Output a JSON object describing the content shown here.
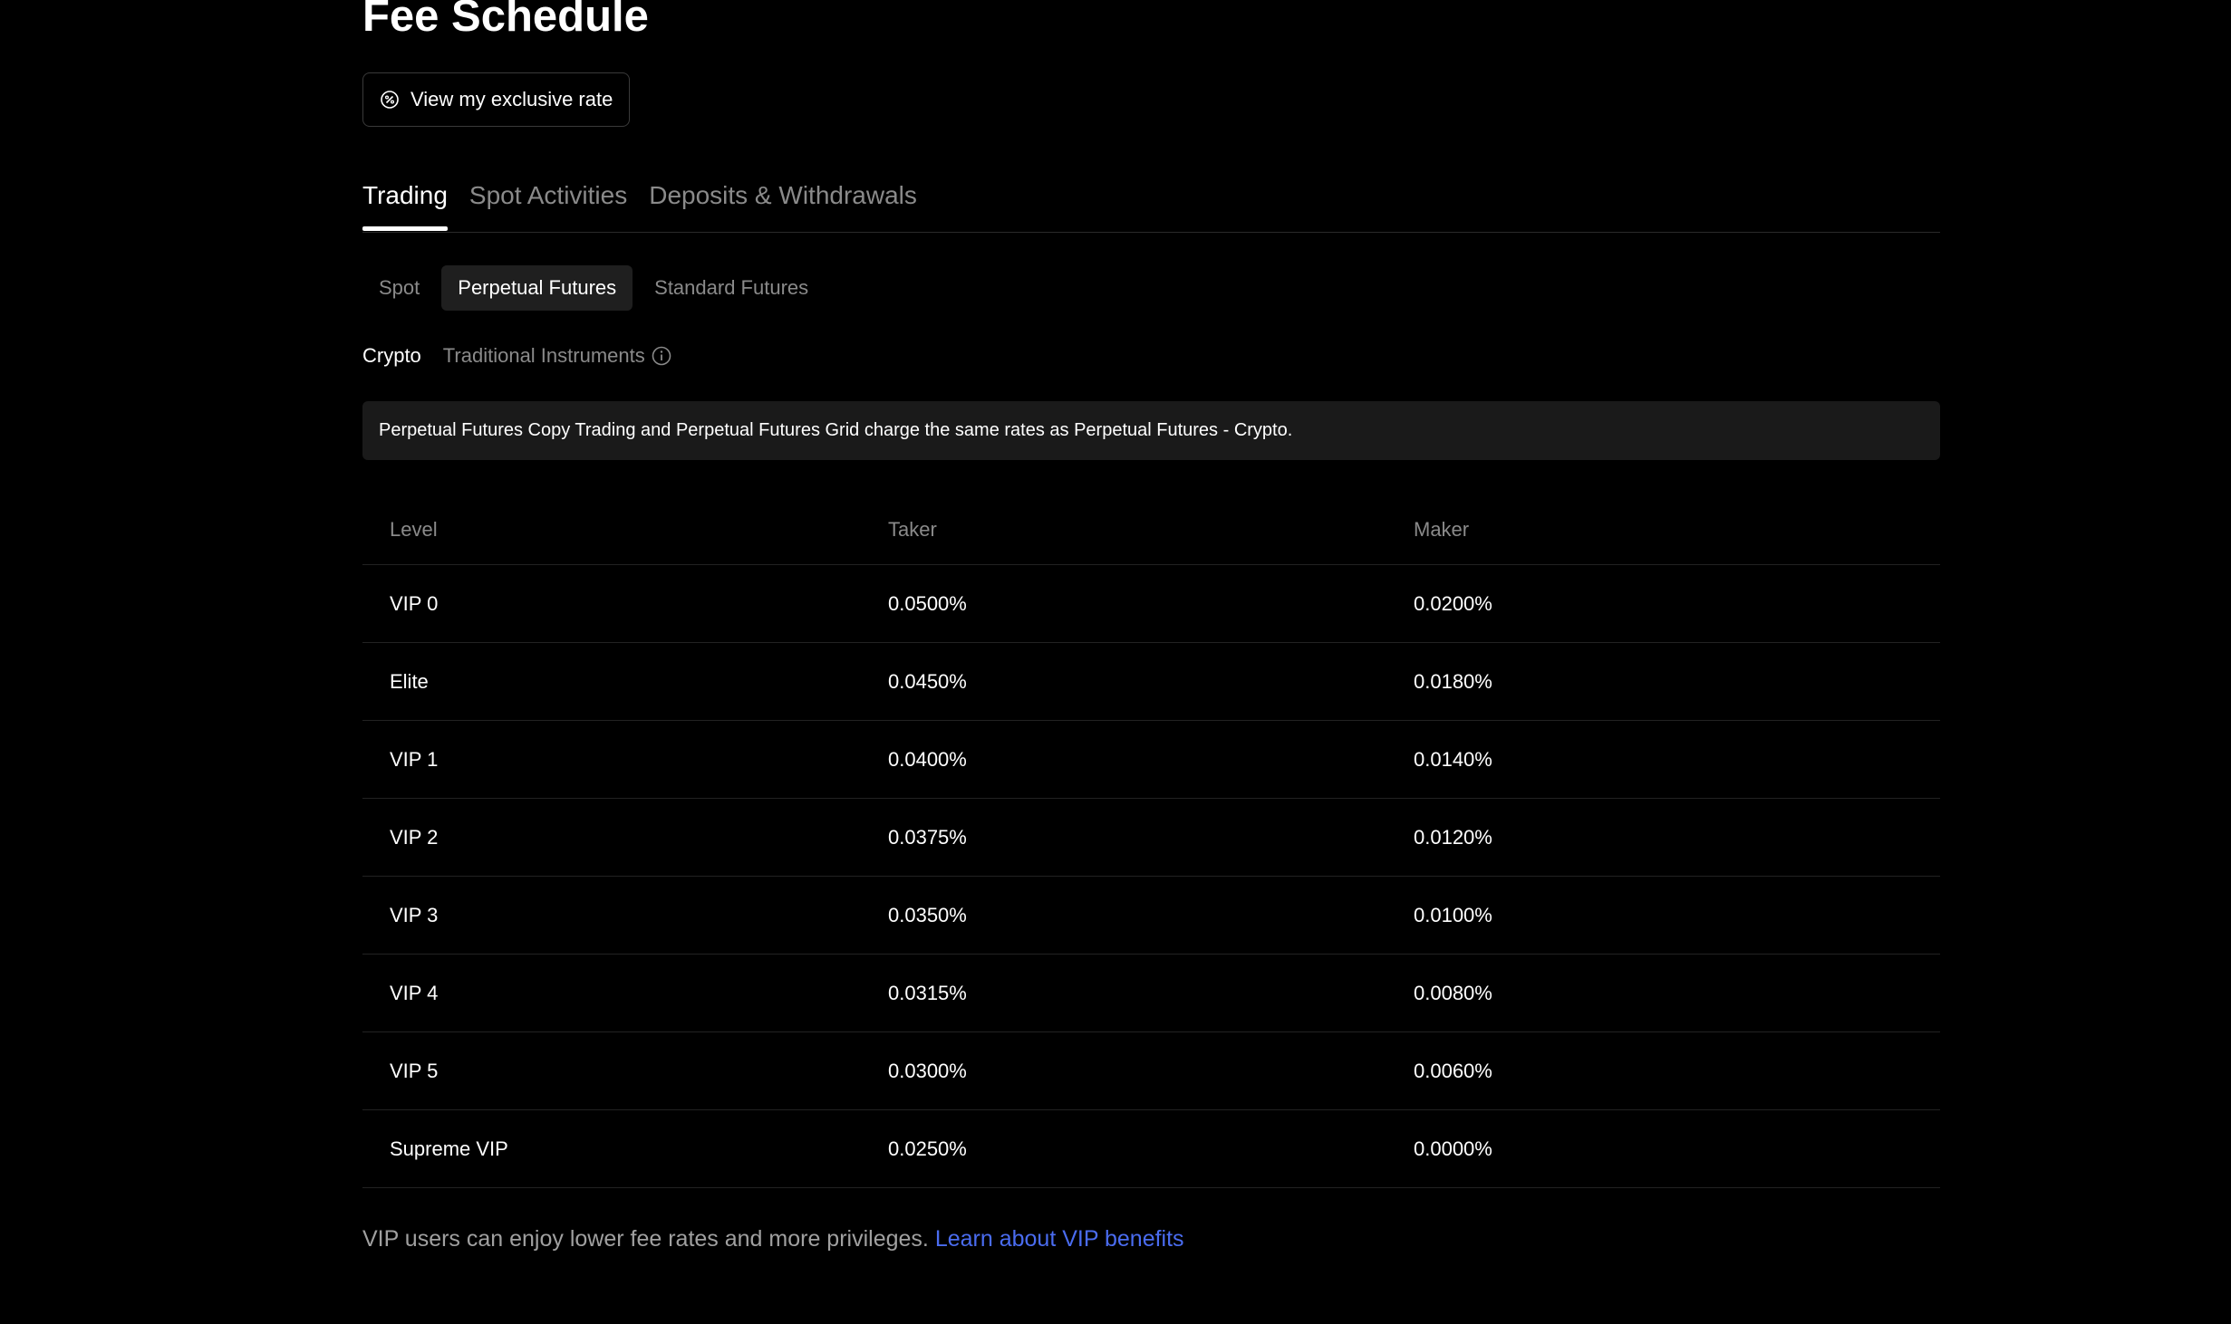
{
  "page_title": "Fee Schedule",
  "rate_button": {
    "label": "View my exclusive rate",
    "icon": "percent-circle-icon"
  },
  "main_tabs": [
    {
      "label": "Trading",
      "active": true
    },
    {
      "label": "Spot Activities",
      "active": false
    },
    {
      "label": "Deposits & Withdrawals",
      "active": false
    }
  ],
  "sub_tabs": [
    {
      "label": "Spot",
      "active": false
    },
    {
      "label": "Perpetual Futures",
      "active": true
    },
    {
      "label": "Standard Futures",
      "active": false
    }
  ],
  "asset_tabs": [
    {
      "label": "Crypto",
      "active": true
    },
    {
      "label": "Traditional Instruments",
      "active": false,
      "icon": "info-icon"
    }
  ],
  "notice": "Perpetual Futures Copy Trading and Perpetual Futures Grid charge the same rates as Perpetual Futures - Crypto.",
  "table": {
    "headers": {
      "level": "Level",
      "taker": "Taker",
      "maker": "Maker"
    },
    "rows": [
      {
        "level": "VIP 0",
        "taker": "0.0500%",
        "maker": "0.0200%"
      },
      {
        "level": "Elite",
        "taker": "0.0450%",
        "maker": "0.0180%"
      },
      {
        "level": "VIP 1",
        "taker": "0.0400%",
        "maker": "0.0140%"
      },
      {
        "level": "VIP 2",
        "taker": "0.0375%",
        "maker": "0.0120%"
      },
      {
        "level": "VIP 3",
        "taker": "0.0350%",
        "maker": "0.0100%"
      },
      {
        "level": "VIP 4",
        "taker": "0.0315%",
        "maker": "0.0080%"
      },
      {
        "level": "VIP 5",
        "taker": "0.0300%",
        "maker": "0.0060%"
      },
      {
        "level": "Supreme VIP",
        "taker": "0.0250%",
        "maker": "0.0000%"
      }
    ]
  },
  "footer": {
    "text": "VIP users can enjoy lower fee rates and more privileges.",
    "link_label": "Learn about VIP benefits"
  },
  "colors": {
    "background": "#000000",
    "link": "#4a6cf0",
    "muted_text": "#8a8a8a"
  }
}
